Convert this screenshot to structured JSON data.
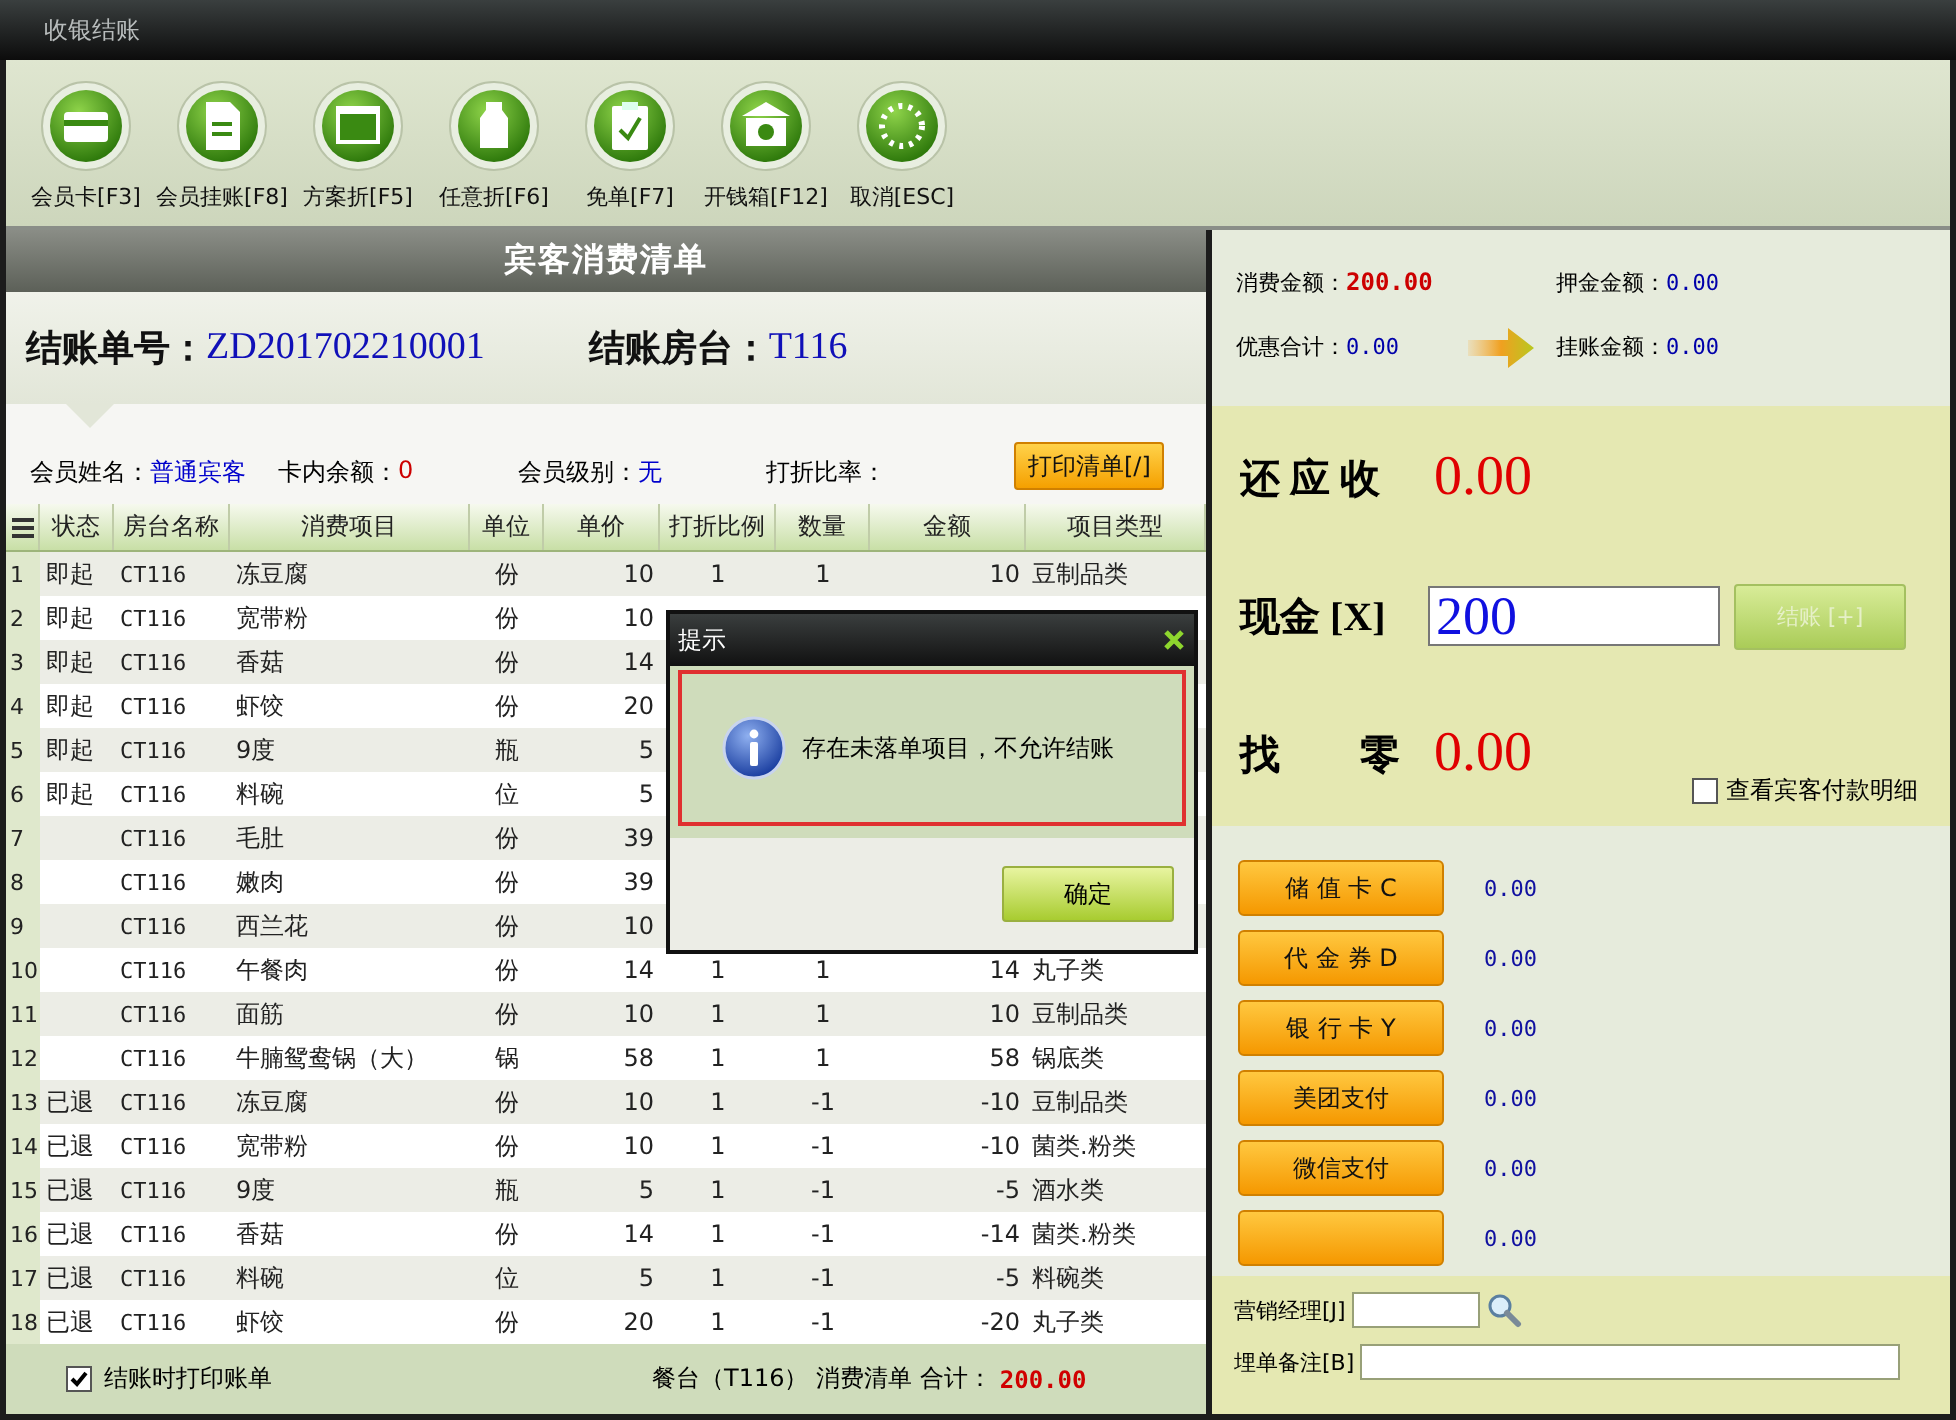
{
  "window": {
    "title": "收银结账"
  },
  "toolbar": [
    {
      "kind": "card",
      "label": "会员卡[F3]"
    },
    {
      "kind": "document",
      "label": "会员挂账[F8]"
    },
    {
      "kind": "window",
      "label": "方案折[F5]"
    },
    {
      "kind": "bottle",
      "label": "任意折[F6]"
    },
    {
      "kind": "clipboard",
      "label": "免单[F7]"
    },
    {
      "kind": "building",
      "label": "开钱箱[F12]"
    },
    {
      "kind": "ring",
      "label": "取消[ESC]"
    }
  ],
  "bill": {
    "header": "宾客消费清单",
    "number_label": "结账单号：",
    "number": "ZD201702210001",
    "room_label": "结账房台：",
    "room": "T116"
  },
  "member": {
    "fields": [
      {
        "label": "会员姓名：",
        "value": "普通宾客",
        "color": "#0000cc"
      },
      {
        "label": "卡内余额：",
        "value": "0",
        "color": "#cc0000"
      },
      {
        "label": "会员级别：",
        "value": "无",
        "color": "#0000cc"
      },
      {
        "label": "打折比率："
      }
    ],
    "print_button": "打印清单[/]"
  },
  "table": {
    "columns": [
      "状态",
      "房台名称",
      "消费项目",
      "单位",
      "单价",
      "打折比例",
      "数量",
      "金额",
      "项目类型"
    ],
    "rows": [
      {
        "no": "1",
        "status": "即起",
        "room": "CT116",
        "item": "冻豆腐",
        "unit": "份",
        "price": "10",
        "discount": "1",
        "qty": "1",
        "amount": "10",
        "category": "豆制品类"
      },
      {
        "no": "2",
        "status": "即起",
        "room": "CT116",
        "item": "宽带粉",
        "unit": "份",
        "price": "10"
      },
      {
        "no": "3",
        "status": "即起",
        "room": "CT116",
        "item": "香菇",
        "unit": "份",
        "price": "14"
      },
      {
        "no": "4",
        "status": "即起",
        "room": "CT116",
        "item": "虾饺",
        "unit": "份",
        "price": "20"
      },
      {
        "no": "5",
        "status": "即起",
        "room": "CT116",
        "item": "9度",
        "unit": "瓶",
        "price": "5"
      },
      {
        "no": "6",
        "status": "即起",
        "room": "CT116",
        "item": "料碗",
        "unit": "位",
        "price": "5"
      },
      {
        "no": "7",
        "room": "CT116",
        "item": "毛肚",
        "unit": "份",
        "price": "39"
      },
      {
        "no": "8",
        "room": "CT116",
        "item": "嫩肉",
        "unit": "份",
        "price": "39"
      },
      {
        "no": "9",
        "room": "CT116",
        "item": "西兰花",
        "unit": "份",
        "price": "10"
      },
      {
        "no": "10",
        "room": "CT116",
        "item": "午餐肉",
        "unit": "份",
        "price": "14",
        "discount": "1",
        "qty": "1",
        "amount": "14",
        "category": "丸子类"
      },
      {
        "no": "11",
        "room": "CT116",
        "item": "面筋",
        "unit": "份",
        "price": "10",
        "discount": "1",
        "qty": "1",
        "amount": "10",
        "category": "豆制品类"
      },
      {
        "no": "12",
        "room": "CT116",
        "item": "牛腩鸳鸯锅（大）",
        "unit": "锅",
        "price": "58",
        "discount": "1",
        "qty": "1",
        "amount": "58",
        "category": "锅底类"
      },
      {
        "no": "13",
        "status": "已退",
        "room": "CT116",
        "item": "冻豆腐",
        "unit": "份",
        "price": "10",
        "discount": "1",
        "qty": "-1",
        "amount": "-10",
        "category": "豆制品类"
      },
      {
        "no": "14",
        "status": "已退",
        "room": "CT116",
        "item": "宽带粉",
        "unit": "份",
        "price": "10",
        "discount": "1",
        "qty": "-1",
        "amount": "-10",
        "category": "菌类.粉类"
      },
      {
        "no": "15",
        "status": "已退",
        "room": "CT116",
        "item": "9度",
        "unit": "瓶",
        "price": "5",
        "discount": "1",
        "qty": "-1",
        "amount": "-5",
        "category": "酒水类"
      },
      {
        "no": "16",
        "status": "已退",
        "room": "CT116",
        "item": "香菇",
        "unit": "份",
        "price": "14",
        "discount": "1",
        "qty": "-1",
        "amount": "-14",
        "category": "菌类.粉类"
      },
      {
        "no": "17",
        "status": "已退",
        "room": "CT116",
        "item": "料碗",
        "unit": "位",
        "price": "5",
        "discount": "1",
        "qty": "-1",
        "amount": "-5",
        "category": "料碗类"
      },
      {
        "no": "18",
        "status": "已退",
        "room": "CT116",
        "item": "虾饺",
        "unit": "份",
        "price": "20",
        "discount": "1",
        "qty": "-1",
        "amount": "-20",
        "category": "丸子类"
      }
    ]
  },
  "footer": {
    "print_on_checkout": {
      "label": "结账时打印账单",
      "checked": true
    },
    "summary": "餐台（T116） 消费清单 合计：",
    "total": "200.00"
  },
  "dialog": {
    "title": "提示",
    "message": "存在未落单项目，不允许结账",
    "ok": "确定"
  },
  "summary": [
    {
      "label": "消费金额：",
      "value": "200.00",
      "color": "#cc0000"
    },
    {
      "label": "押金金额：",
      "value": "0.00",
      "color": "#0000aa"
    },
    {
      "label": "优惠合计：",
      "value": "0.00",
      "color": "#0000aa"
    },
    {
      "label": "挂账金额：",
      "value": "0.00",
      "color": "#0000aa"
    }
  ],
  "payment": {
    "due_label": "还 应 收",
    "due": "0.00",
    "cash_label": "现金 [X]",
    "cash": "200",
    "settle": {
      "label": "结账 [+]",
      "disabled": true
    },
    "change_label": "找　　零",
    "change": "0.00",
    "detail": {
      "label": "查看宾客付款明细",
      "checked": false
    }
  },
  "methods": [
    {
      "label": "储 值 卡 C",
      "amount": "0.00"
    },
    {
      "label": "代 金 券 D",
      "amount": "0.00"
    },
    {
      "label": "银 行 卡 Y",
      "amount": "0.00"
    },
    {
      "label": "美团支付",
      "amount": "0.00"
    },
    {
      "label": "微信支付",
      "amount": "0.00"
    },
    {
      "amount": "0.00"
    }
  ],
  "extras": {
    "manager_label": "营销经理[J]",
    "remark_label": "埋单备注[B]"
  }
}
